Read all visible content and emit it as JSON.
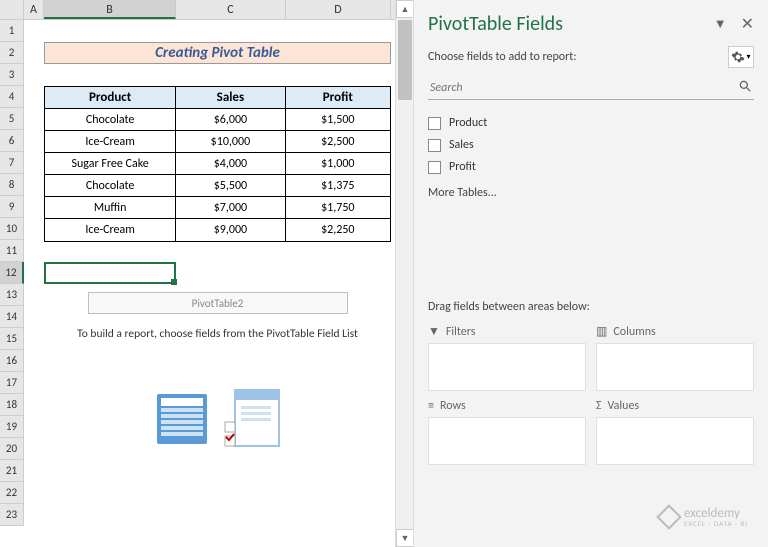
{
  "columns": [
    "A",
    "B",
    "C",
    "D"
  ],
  "selected_col": "B",
  "selected_row": 12,
  "rows": [
    1,
    2,
    3,
    4,
    5,
    6,
    7,
    8,
    9,
    10,
    11,
    12,
    13,
    14,
    15,
    16,
    17,
    18,
    19,
    20,
    21,
    22,
    23
  ],
  "banner": "Creating Pivot Table",
  "table": {
    "headers": [
      "Product",
      "Sales",
      "Profit"
    ],
    "rows": [
      [
        "Chocolate",
        "$6,000",
        "$1,500"
      ],
      [
        "Ice-Cream",
        "$10,000",
        "$2,500"
      ],
      [
        "Sugar Free Cake",
        "$4,000",
        "$1,000"
      ],
      [
        "Chocolate",
        "$5,500",
        "$1,375"
      ],
      [
        "Muffin",
        "$7,000",
        "$1,750"
      ],
      [
        "Ice-Cream",
        "$9,000",
        "$2,250"
      ]
    ]
  },
  "pivot_placeholder": {
    "name": "PivotTable2",
    "hint": "To build a report, choose fields from the PivotTable Field List"
  },
  "pane": {
    "title": "PivotTable Fields",
    "subtitle": "Choose fields to add to report:",
    "search_placeholder": "Search",
    "fields": [
      "Product",
      "Sales",
      "Profit"
    ],
    "more_tables": "More Tables...",
    "drag_label": "Drag fields between areas below:",
    "areas": {
      "filters": "Filters",
      "columns": "Columns",
      "rows": "Rows",
      "values": "Values"
    }
  },
  "watermark": {
    "brand": "exceldemy",
    "tag": "EXCEL · DATA · BI"
  }
}
